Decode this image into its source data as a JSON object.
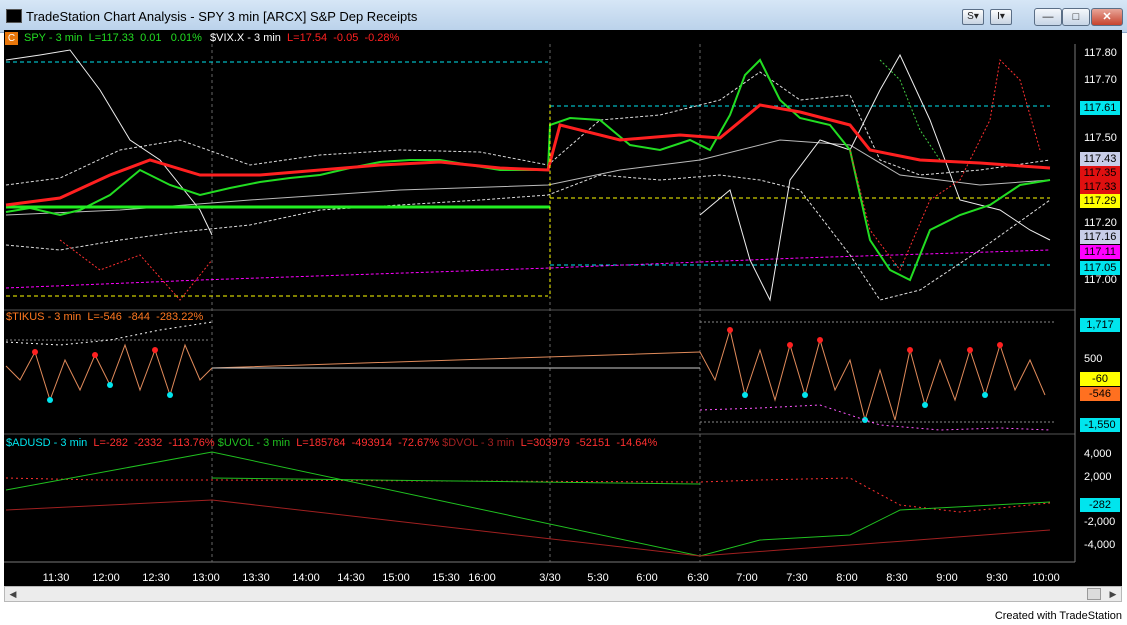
{
  "window": {
    "title": "TradeStation Chart Analysis - SPY 3 min [ARCX] S&P Dep Receipts",
    "s_button": "S",
    "i_button": "I",
    "minimize_glyph": "—",
    "maximize_glyph": "□",
    "close_glyph": "✕"
  },
  "legend": {
    "c_badge": "C",
    "spy": {
      "symbol": "SPY - 3 min",
      "last": "L=117.33",
      "chg": "0.01",
      "pct": "0.01%"
    },
    "vix": {
      "symbol": "$VIX.X - 3 min",
      "last": "L=17.54",
      "chg": "-0.05",
      "pct": "-0.28%"
    }
  },
  "tikus_legend": {
    "symbol": "$TIKUS - 3 min",
    "last": "L=-546",
    "chg": "-844",
    "pct": "-283.22%"
  },
  "adusd_legend": {
    "adusd": {
      "symbol": "$ADUSD - 3 min",
      "last": "L=-282",
      "chg": "-2332",
      "pct": "-113.76%"
    },
    "uvol": {
      "symbol": "$UVOL - 3 min",
      "last": "L=185784",
      "chg": "-493914",
      "pct": "-72.67%"
    },
    "dvol": {
      "symbol": "$DVOL - 3 min",
      "last": "L=303979",
      "chg": "-52151",
      "pct": "-14.64%"
    }
  },
  "price_axis": {
    "labels": [
      "117.80",
      "117.70",
      "117.50",
      "117.20",
      "117.00"
    ],
    "tags": [
      {
        "text": "117.61",
        "bg": "#00e5ee",
        "fg": "#000000"
      },
      {
        "text": "117.43",
        "bg": "#c8cde8",
        "fg": "#000000"
      },
      {
        "text": "117.35",
        "bg": "#e01010",
        "fg": "#000000"
      },
      {
        "text": "117.33",
        "bg": "#e01010",
        "fg": "#000000"
      },
      {
        "text": "117.29",
        "bg": "#ffff00",
        "fg": "#000000"
      },
      {
        "text": "117.16",
        "bg": "#c8cde8",
        "fg": "#000000"
      },
      {
        "text": "117.11",
        "bg": "#ff00ff",
        "fg": "#000000"
      },
      {
        "text": "117.05",
        "bg": "#00e5ee",
        "fg": "#000000"
      }
    ]
  },
  "tikus_axis": {
    "labels": [
      "500"
    ],
    "tags": [
      {
        "text": "1,717",
        "bg": "#00e5ee",
        "fg": "#000000"
      },
      {
        "text": "-60",
        "bg": "#ffff00",
        "fg": "#000000"
      },
      {
        "text": "-546",
        "bg": "#ff7020",
        "fg": "#000000"
      },
      {
        "text": "-1,550",
        "bg": "#00e5ee",
        "fg": "#000000"
      }
    ]
  },
  "adusd_axis": {
    "labels": [
      "4,000",
      "2,000",
      "-2,000",
      "-4,000"
    ],
    "tags": [
      {
        "text": "-282",
        "bg": "#00e5ee",
        "fg": "#000000"
      }
    ]
  },
  "time_axis": [
    "11:30",
    "12:00",
    "12:30",
    "13:00",
    "13:30",
    "14:00",
    "14:30",
    "15:00",
    "15:30",
    "16:00",
    "3/30",
    "5:30",
    "6:00",
    "6:30",
    "7:00",
    "7:30",
    "8:00",
    "8:30",
    "9:00",
    "9:30",
    "10:00"
  ],
  "footer": "Created with TradeStation",
  "colors": {
    "spy_up": "#22dd22",
    "spy_down": "#ff1010",
    "vix": "#ff2020",
    "tikus_label": "#ff7820",
    "adusd_label": "#00e5ee",
    "uvol_label": "#20c020",
    "dvol_label": "#a02020"
  }
}
